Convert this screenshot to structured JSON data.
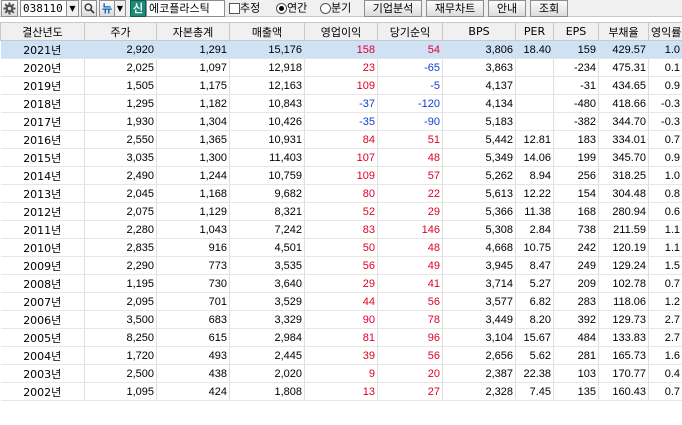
{
  "toolbar": {
    "code": "038110",
    "tag": "신",
    "stock_name": "에코플라스틱",
    "estimate_label": "추정",
    "annual_label": "연간",
    "quarter_label": "분기",
    "company_analysis": "기업분석",
    "financial_chart": "재무차트",
    "guide": "안내",
    "query": "조회",
    "settings_icon": "gear-icon",
    "search_icon": "search-icon",
    "news_label": "뉴"
  },
  "grid": {
    "headers": [
      "결산년도",
      "주가",
      "자본총계",
      "매출액",
      "영업이익",
      "당기순익",
      "BPS",
      "PER",
      "EPS",
      "부채율",
      "영익률"
    ],
    "rows": [
      [
        "2021년",
        "2,920",
        "1,291",
        "15,176",
        "158",
        "54",
        "3,806",
        "18.40",
        "159",
        "429.57",
        "1.0"
      ],
      [
        "2020년",
        "2,025",
        "1,097",
        "12,918",
        "23",
        "-65",
        "3,863",
        "",
        "-234",
        "475.31",
        "0.1"
      ],
      [
        "2019년",
        "1,505",
        "1,175",
        "12,163",
        "109",
        "-5",
        "4,137",
        "",
        "-31",
        "434.65",
        "0.9"
      ],
      [
        "2018년",
        "1,295",
        "1,182",
        "10,843",
        "-37",
        "-120",
        "4,134",
        "",
        "-480",
        "418.66",
        "-0.3"
      ],
      [
        "2017년",
        "1,930",
        "1,304",
        "10,426",
        "-35",
        "-90",
        "5,183",
        "",
        "-382",
        "344.70",
        "-0.3"
      ],
      [
        "2016년",
        "2,550",
        "1,365",
        "10,931",
        "84",
        "51",
        "5,442",
        "12.81",
        "183",
        "334.01",
        "0.7"
      ],
      [
        "2015년",
        "3,035",
        "1,300",
        "11,403",
        "107",
        "48",
        "5,349",
        "14.06",
        "199",
        "345.70",
        "0.9"
      ],
      [
        "2014년",
        "2,490",
        "1,244",
        "10,759",
        "109",
        "57",
        "5,262",
        "8.94",
        "256",
        "318.25",
        "1.0"
      ],
      [
        "2013년",
        "2,045",
        "1,168",
        "9,682",
        "80",
        "22",
        "5,613",
        "12.22",
        "154",
        "304.48",
        "0.8"
      ],
      [
        "2012년",
        "2,075",
        "1,129",
        "8,321",
        "52",
        "29",
        "5,366",
        "11.38",
        "168",
        "280.94",
        "0.6"
      ],
      [
        "2011년",
        "2,280",
        "1,043",
        "7,242",
        "83",
        "146",
        "5,308",
        "2.84",
        "738",
        "211.59",
        "1.1"
      ],
      [
        "2010년",
        "2,835",
        "916",
        "4,501",
        "50",
        "48",
        "4,668",
        "10.75",
        "242",
        "120.19",
        "1.1"
      ],
      [
        "2009년",
        "2,290",
        "773",
        "3,535",
        "56",
        "49",
        "3,945",
        "8.47",
        "249",
        "129.24",
        "1.5"
      ],
      [
        "2008년",
        "1,195",
        "730",
        "3,640",
        "29",
        "41",
        "3,714",
        "5.27",
        "209",
        "102.78",
        "0.7"
      ],
      [
        "2007년",
        "2,095",
        "701",
        "3,529",
        "44",
        "56",
        "3,577",
        "6.82",
        "283",
        "118.06",
        "1.2"
      ],
      [
        "2006년",
        "3,500",
        "683",
        "3,329",
        "90",
        "78",
        "3,449",
        "8.20",
        "392",
        "129.73",
        "2.7"
      ],
      [
        "2005년",
        "8,250",
        "615",
        "2,984",
        "81",
        "96",
        "3,104",
        "15.67",
        "484",
        "133.83",
        "2.7"
      ],
      [
        "2004년",
        "1,720",
        "493",
        "2,445",
        "39",
        "56",
        "2,656",
        "5.62",
        "281",
        "165.73",
        "1.6"
      ],
      [
        "2003년",
        "2,500",
        "438",
        "2,020",
        "9",
        "20",
        "2,387",
        "22.38",
        "103",
        "170.77",
        "0.4"
      ],
      [
        "2002년",
        "1,095",
        "424",
        "1,808",
        "13",
        "27",
        "2,328",
        "7.45",
        "135",
        "160.43",
        "0.7"
      ]
    ],
    "selected_row": 0,
    "colors": {
      "positive": "#e0002a",
      "negative": "#1040d0",
      "selected": "#cfe1f5"
    }
  }
}
